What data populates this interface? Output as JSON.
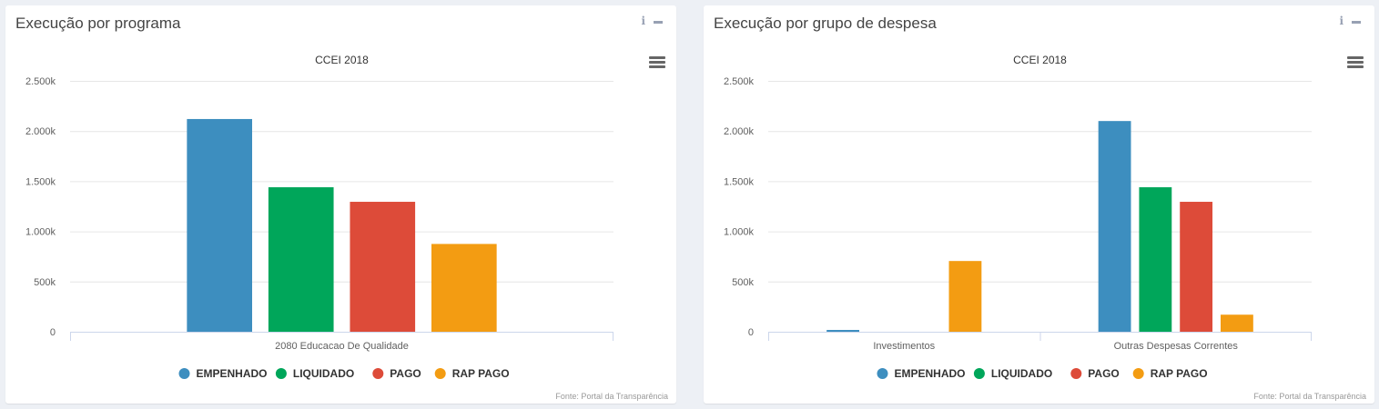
{
  "panels": [
    {
      "title": "Execução por programa",
      "info_icon": "info-icon",
      "minimize_icon": "minimize-icon",
      "menu_icon": "hamburger-menu-icon"
    },
    {
      "title": "Execução por grupo de despesa",
      "info_icon": "info-icon",
      "minimize_icon": "minimize-icon",
      "menu_icon": "hamburger-menu-icon"
    }
  ],
  "info_glyph": "i",
  "credits": "Fonte: Portal da Transparência",
  "chart_data": [
    {
      "type": "bar",
      "title": "CCEI 2018",
      "categories": [
        "2080 Educacao De Qualidade"
      ],
      "series": [
        {
          "name": "EMPENHADO",
          "color": "#3d8ebf",
          "values": [
            2120000
          ]
        },
        {
          "name": "LIQUIDADO",
          "color": "#00a65a",
          "values": [
            1440000
          ]
        },
        {
          "name": "PAGO",
          "color": "#dd4b39",
          "values": [
            1295000
          ]
        },
        {
          "name": "RAP PAGO",
          "color": "#f39c12",
          "values": [
            875000
          ]
        }
      ],
      "ylim": [
        0,
        2500000
      ],
      "yticks": [
        0,
        500000,
        1000000,
        1500000,
        2000000,
        2500000
      ],
      "ytick_labels": [
        "0",
        "500k",
        "1.000k",
        "1.500k",
        "2.000k",
        "2.500k"
      ],
      "grid": true,
      "legend": "bottom-center"
    },
    {
      "type": "bar",
      "title": "CCEI 2018",
      "categories": [
        "Investimentos",
        "Outras Despesas Correntes"
      ],
      "series": [
        {
          "name": "EMPENHADO",
          "color": "#3d8ebf",
          "values": [
            18000,
            2100000
          ]
        },
        {
          "name": "LIQUIDADO",
          "color": "#00a65a",
          "values": [
            0,
            1440000
          ]
        },
        {
          "name": "PAGO",
          "color": "#dd4b39",
          "values": [
            0,
            1295000
          ]
        },
        {
          "name": "RAP PAGO",
          "color": "#f39c12",
          "values": [
            705000,
            170000
          ]
        }
      ],
      "ylim": [
        0,
        2500000
      ],
      "yticks": [
        0,
        500000,
        1000000,
        1500000,
        2000000,
        2500000
      ],
      "ytick_labels": [
        "0",
        "500k",
        "1.000k",
        "1.500k",
        "2.000k",
        "2.500k"
      ],
      "grid": true,
      "legend": "bottom-center"
    }
  ]
}
